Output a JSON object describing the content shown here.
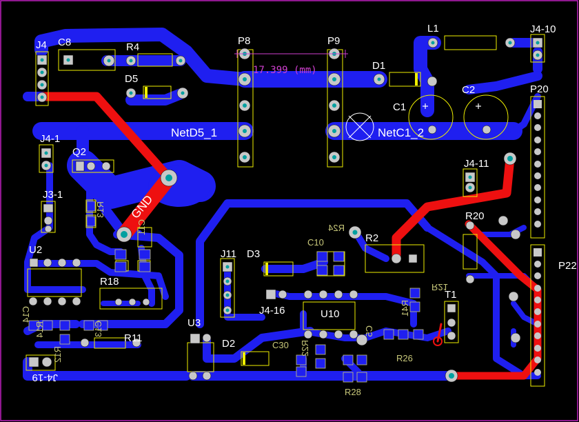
{
  "colors": {
    "background": "#000000",
    "bottom_copper": "#1f1ff0",
    "top_copper": "#ee1010",
    "silkscreen": "#f0f000",
    "pad": "#c8c8c8",
    "via_hole": "#00a0a0",
    "board_outline": "#c020c0",
    "dimension": "#d040d0"
  },
  "components": {
    "J4": "J4",
    "C8": "C8",
    "R4": "R4",
    "D5": "D5",
    "P8": "P8",
    "P9": "P9",
    "D1": "D1",
    "L1": "L1",
    "J4_10": "J4-10",
    "C1": "C1",
    "C2": "C2",
    "P20": "P20",
    "J4_1": "J4-1",
    "Q2": "Q2",
    "J4_11": "J4-11",
    "J3_1": "J3-1",
    "R13": "R13",
    "C11": "C11",
    "R24": "R24",
    "C10": "C10",
    "R2": "R2",
    "R20": "R20",
    "P22": "P22",
    "U2": "U2",
    "R18": "R18",
    "J11": "J11",
    "D3": "D3",
    "R21": "R21",
    "R41": "R41",
    "T1": "T1",
    "C14": "C14",
    "R14": "R14",
    "C13": "C13",
    "J4_16": "J4-16",
    "U10": "U10",
    "C5": "C5",
    "U3": "U3",
    "R11": "R11",
    "R12": "R12",
    "D2": "D2",
    "C30": "C30",
    "R22": "R22",
    "R26": "R26",
    "R28": "R28",
    "J4_19": "J4-19"
  },
  "nets": {
    "netd5": "NetD5_1",
    "netc1": "NetC1_2",
    "gnd": "GND"
  },
  "dimension_text": "17.399 (mm)"
}
